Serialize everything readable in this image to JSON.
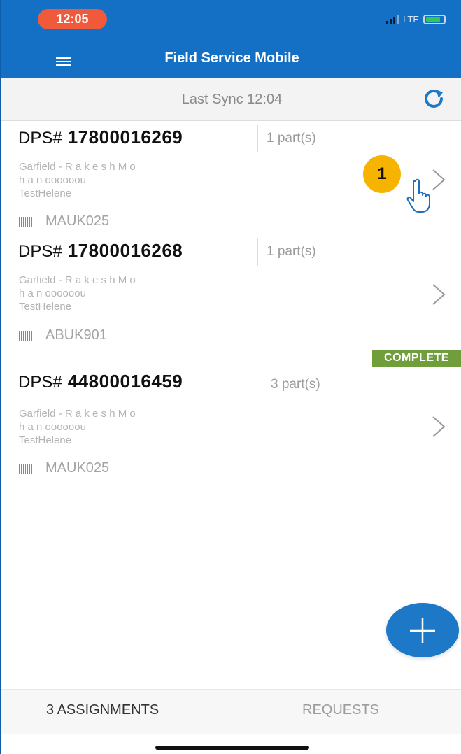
{
  "status": {
    "time": "12:05",
    "network": "LTE"
  },
  "header": {
    "title": "Field Service Mobile"
  },
  "sync": {
    "text": "Last Sync 12:04"
  },
  "assignments": [
    {
      "prefix": "DPS#",
      "number": "17800016269",
      "parts": "1 part(s)",
      "address_lines": [
        "Garfield - R a k e s h M o",
        "h a n oooooou",
        "TestHelene"
      ],
      "code": "MAUK025"
    },
    {
      "prefix": "DPS#",
      "number": "17800016268",
      "parts": "1 part(s)",
      "address_lines": [
        "Garfield - R a k e s h M o",
        "h a n oooooou",
        "TestHelene"
      ],
      "code": "ABUK901"
    },
    {
      "prefix": "DPS#",
      "number": "44800016459",
      "parts": "3 part(s)",
      "address_lines": [
        "Garfield - R a k e s h M o",
        "h a n oooooou",
        "TestHelene"
      ],
      "code": "MAUK025",
      "badge": "COMPLETE"
    }
  ],
  "annotation": {
    "step": "1"
  },
  "tabs": {
    "assignments": "3 ASSIGNMENTS",
    "requests": "REQUESTS"
  },
  "colors": {
    "header": "#1470c4",
    "accent": "#1e78c8",
    "complete": "#6f9e3a",
    "step": "#f6b400"
  },
  "icons": [
    "menu-icon",
    "refresh-icon",
    "chevron-right-icon",
    "barcode-icon",
    "pointing-hand-icon",
    "plus-icon"
  ]
}
